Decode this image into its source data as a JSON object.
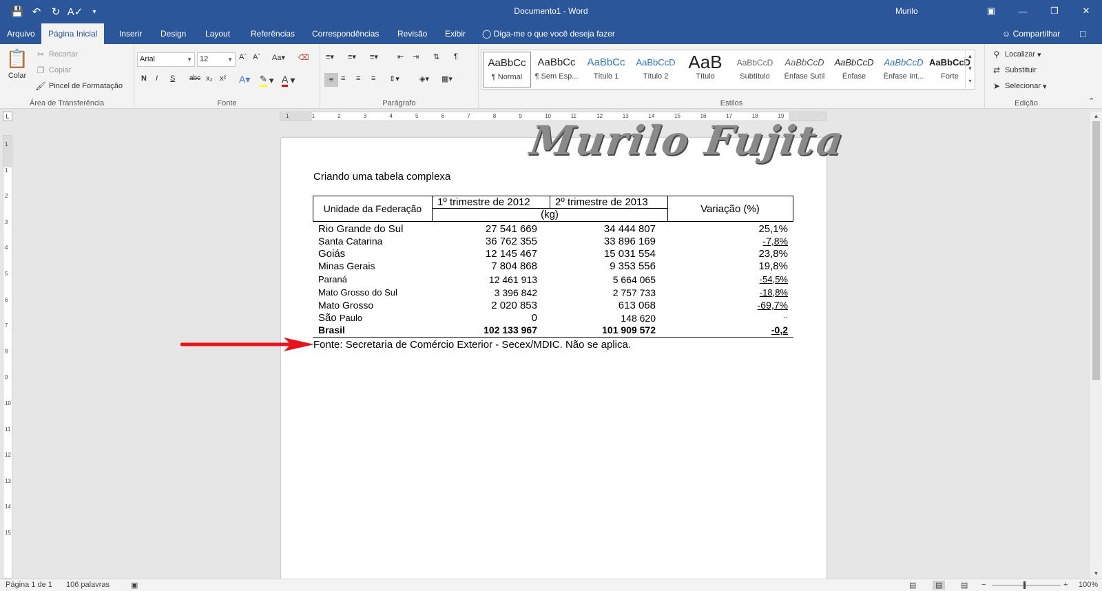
{
  "window": {
    "title": "Documento1  -  Word",
    "user": "Murilo"
  },
  "qat": {
    "save": "save-icon",
    "undo": "undo-icon",
    "redo": "redo-icon",
    "spelling": "spelling-icon",
    "customize": "customize-icon"
  },
  "tabs": [
    "Arquivo",
    "Página Inicial",
    "Inserir",
    "Design",
    "Layout",
    "Referências",
    "Correspondências",
    "Revisão",
    "Exibir"
  ],
  "tellme": "Diga-me o que você deseja fazer",
  "share": "Compartilhar",
  "ribbon": {
    "clipboard": {
      "paste": "Colar",
      "cut": "Recortar",
      "copy": "Copiar",
      "painter": "Pincel de Formatação",
      "label": "Área de Transferência"
    },
    "font": {
      "name": "Arial",
      "size": "12",
      "label": "Fonte",
      "bold": "N",
      "italic": "I",
      "underline": "S",
      "strike": "abc",
      "sub": "x₂",
      "sup": "x²"
    },
    "paragraph": {
      "label": "Parágrafo"
    },
    "styles": {
      "label": "Estilos",
      "items": [
        {
          "preview": "AaBbCc",
          "name": "¶ Normal"
        },
        {
          "preview": "AaBbCc",
          "name": "¶ Sem Esp..."
        },
        {
          "preview": "AaBbCc",
          "name": "Título 1"
        },
        {
          "preview": "AaBbCcD",
          "name": "Título 2"
        },
        {
          "preview": "AaB",
          "name": "Título"
        },
        {
          "preview": "AaBbCcD",
          "name": "Subtítulo"
        },
        {
          "preview": "AaBbCcD",
          "name": "Ênfase Sutil"
        },
        {
          "preview": "AaBbCcD",
          "name": "Ênfase"
        },
        {
          "preview": "AaBbCcD",
          "name": "Ênfase Int..."
        },
        {
          "preview": "AaBbCcD",
          "name": "Forte"
        }
      ]
    },
    "editing": {
      "find": "Localizar",
      "replace": "Substituir",
      "select": "Selecionar",
      "label": "Edição"
    }
  },
  "ruler": {
    "h": [
      "1",
      "1",
      "2",
      "3",
      "4",
      "5",
      "6",
      "7",
      "8",
      "9",
      "10",
      "11",
      "12",
      "13",
      "14",
      "15",
      "16",
      "17",
      "18",
      "19"
    ],
    "v": [
      "1",
      "1",
      "2",
      "3",
      "4",
      "5",
      "6",
      "7",
      "8",
      "9",
      "10",
      "11",
      "12",
      "13",
      "14",
      "15"
    ]
  },
  "document": {
    "watermark": "Murilo Fujita",
    "title": "Criando uma tabela complexa",
    "headers": {
      "uf": "Unidade da Federação",
      "q1": "1º trimestre de 2012",
      "q2": "2º trimestre de 2013",
      "unit": "(kg)",
      "var": "Variação (%)"
    },
    "rows": [
      {
        "uf": "Rio Grande do Sul",
        "a": "27 541 669",
        "b": "34 444 807",
        "v": "25,1%"
      },
      {
        "uf": "Santa Catarina",
        "a": "36 762 355",
        "b": "33 896 169",
        "v": "-7,8%"
      },
      {
        "uf": "Goiás",
        "a": "12 145 467",
        "b": "15 031 554",
        "v": "23,8%"
      },
      {
        "uf": "Minas Gerais",
        "a": "7 804 868",
        "b": "9 353 556",
        "v": "19,8%"
      },
      {
        "uf": "Paraná",
        "a": "12 461 913",
        "b": "5 664 065",
        "v": "-54,5%"
      },
      {
        "uf": "Mato Grosso do Sul",
        "a": "3 396 842",
        "b": "2 757 733",
        "v": "-18,8%"
      },
      {
        "uf": "Mato Grosso",
        "a": "2 020 853",
        "b": "613 068",
        "v": "-69,7%"
      },
      {
        "uf": "São",
        "uf2": "Paulo",
        "a": "0",
        "b": "148 620",
        "v": ".."
      },
      {
        "uf": "Brasil",
        "a": "102 133 967",
        "b": "101 909 572",
        "v": "-0,2"
      }
    ],
    "source": "Fonte: Secretaria de Comércio Exterior - Secex/MDIC. Não se aplica."
  },
  "status": {
    "page": "Página 1 de 1",
    "words": "106 palavras",
    "zoom": "100%"
  },
  "colors": {
    "accent": "#2b579a",
    "arrow": "#e8141b"
  }
}
